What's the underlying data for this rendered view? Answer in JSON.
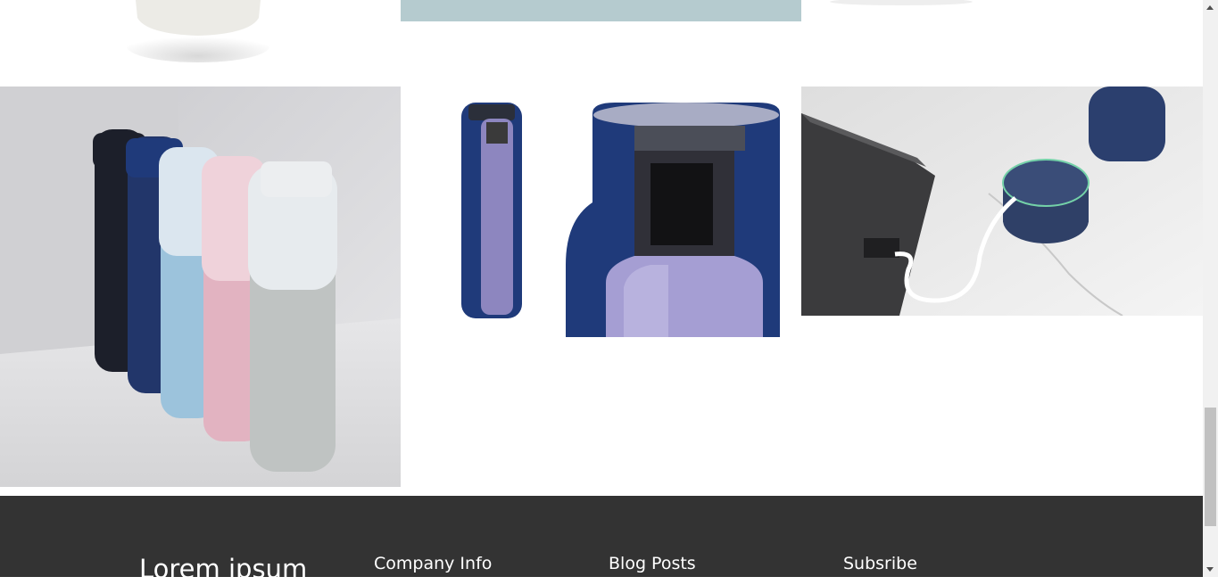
{
  "footer": {
    "brand": "Lorem ipsum",
    "columns": [
      {
        "heading": "Company Info"
      },
      {
        "heading": "Blog Posts"
      },
      {
        "heading": "Subsribe"
      }
    ]
  },
  "colors": {
    "footer_bg": "#333333",
    "footer_text": "#ffffff",
    "navy": "#1f3a7a",
    "page_bg": "#ffffff"
  },
  "icons": {
    "scroll_up": "chevron-up-icon",
    "scroll_down": "chevron-down-icon"
  }
}
